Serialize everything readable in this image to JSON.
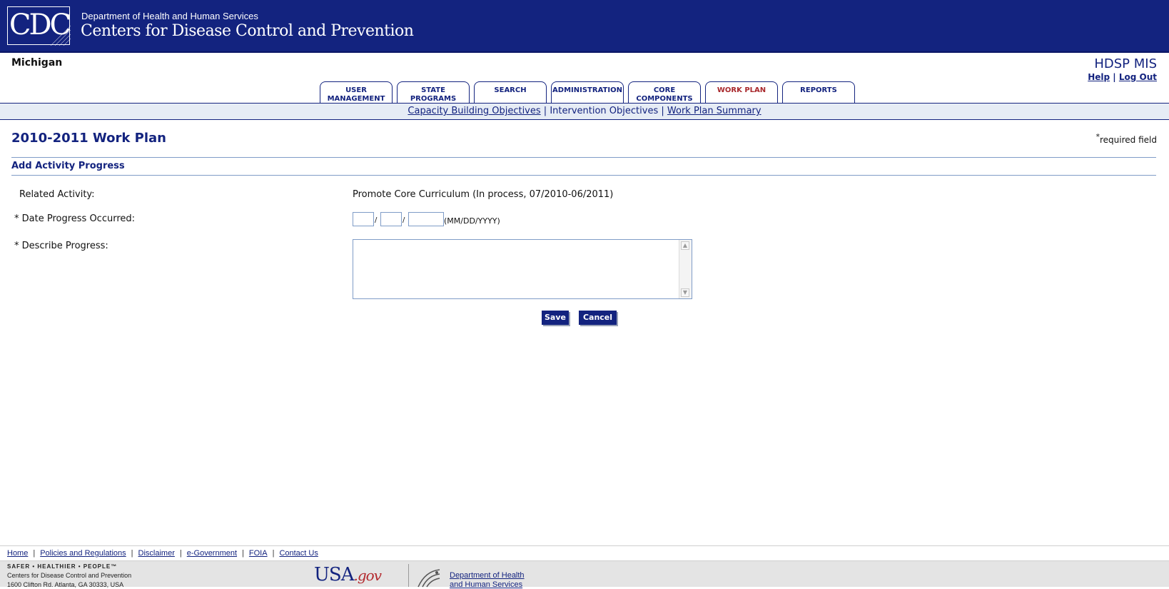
{
  "header": {
    "logo_text": "CDC",
    "department": "Department of Health and Human Services",
    "agency": "Centers for Disease Control and Prevention"
  },
  "top": {
    "state": "Michigan",
    "app_name": "HDSP MIS",
    "help": "Help",
    "separator": "|",
    "logout": "Log Out"
  },
  "tabs": [
    {
      "line1": "USER",
      "line2": "MANAGEMENT"
    },
    {
      "line1": "STATE",
      "line2": "PROGRAMS"
    },
    {
      "line1": "SEARCH",
      "line2": ""
    },
    {
      "line1": "ADMINISTRATION",
      "line2": ""
    },
    {
      "line1": "CORE",
      "line2": "COMPONENTS"
    },
    {
      "line1": "WORK PLAN",
      "line2": ""
    },
    {
      "line1": "REPORTS",
      "line2": ""
    }
  ],
  "subnav": {
    "capacity": "Capacity Building Objectives",
    "intervention": "Intervention Objectives",
    "summary": "Work Plan Summary",
    "separator": "|"
  },
  "page": {
    "title": "2010-2011 Work Plan",
    "required_star": "*",
    "required_text": "required field",
    "section_title": "Add Activity Progress"
  },
  "form": {
    "related_label": "Related Activity:",
    "related_value": "Promote Core Curriculum (In process, 07/2010-06/2011)",
    "date_label": "* Date Progress Occurred:",
    "date_sep": "/",
    "date_format": "(MM/DD/YYYY)",
    "month_value": "",
    "day_value": "",
    "year_value": "",
    "describe_label": "* Describe Progress:",
    "describe_value": "",
    "save": "Save",
    "cancel": "Cancel"
  },
  "footer": {
    "links": [
      "Home",
      "Policies and Regulations",
      "Disclaimer",
      "e-Government",
      "FOIA",
      "Contact Us"
    ],
    "separator": "|",
    "tagline": "SAFER • HEALTHIER • PEOPLE™",
    "address1": "Centers for Disease Control and Prevention",
    "address2": "1600 Clifton Rd. Atlanta, GA 30333, USA",
    "usagov_main": "USA",
    "usagov_gov": ".gov",
    "hhs_line1": "Department of Health",
    "hhs_line2": "and Human Services"
  },
  "colors": {
    "header_blue": "#13237f",
    "active_tab": "#a8282c",
    "nav_strip": "#e6ecf5"
  }
}
